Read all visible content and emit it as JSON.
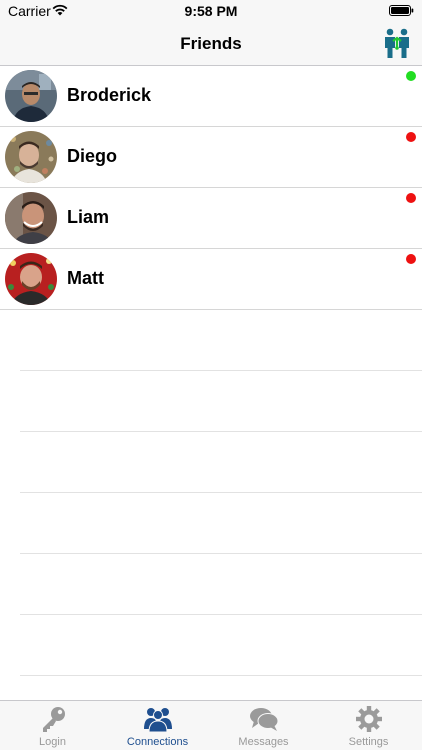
{
  "status_bar": {
    "carrier": "Carrier",
    "time": "9:58 PM"
  },
  "nav": {
    "title": "Friends",
    "right_icon": "friends-connect-icon"
  },
  "friends": [
    {
      "name": "Broderick",
      "status": "online",
      "status_color": "#22dd22"
    },
    {
      "name": "Diego",
      "status": "offline",
      "status_color": "#ee1111"
    },
    {
      "name": "Liam",
      "status": "offline",
      "status_color": "#ee1111"
    },
    {
      "name": "Matt",
      "status": "offline",
      "status_color": "#ee1111"
    }
  ],
  "tabs": [
    {
      "label": "Login",
      "icon": "key-icon",
      "active": false
    },
    {
      "label": "Connections",
      "icon": "people-icon",
      "active": true
    },
    {
      "label": "Messages",
      "icon": "chat-bubbles-icon",
      "active": false
    },
    {
      "label": "Settings",
      "icon": "gear-icon",
      "active": false
    }
  ],
  "colors": {
    "accent": "#1f4f8f",
    "inactive_tab": "#999999",
    "online": "#22dd22",
    "offline": "#ee1111"
  }
}
